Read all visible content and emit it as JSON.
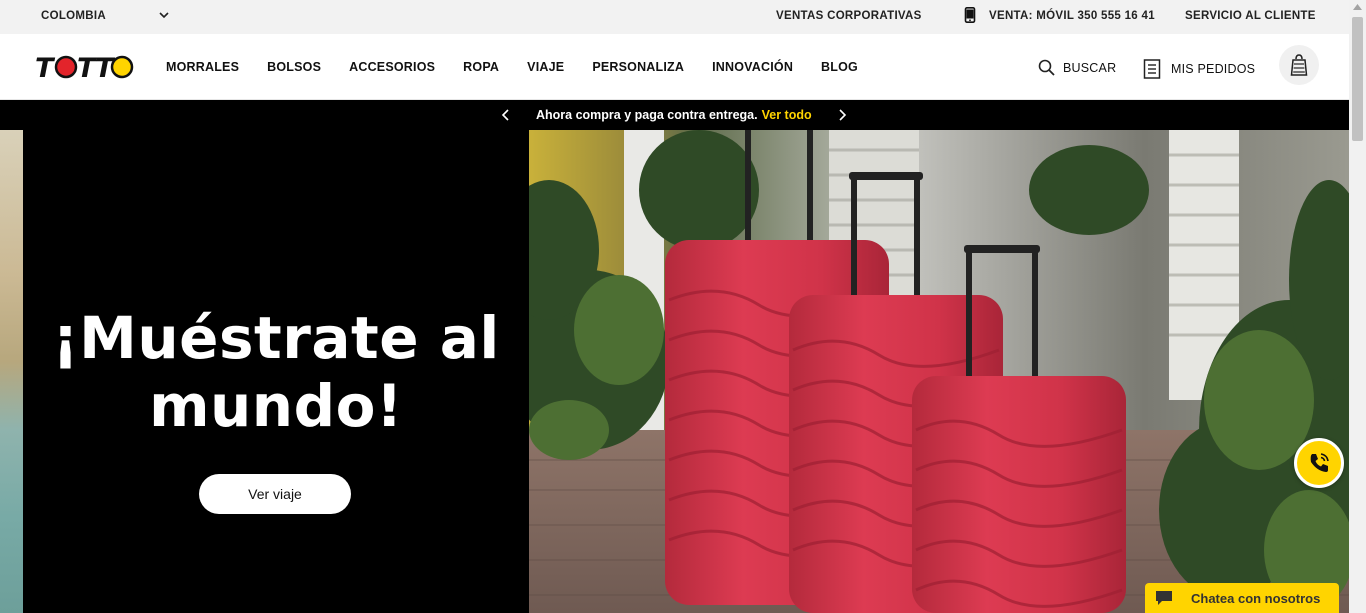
{
  "topbar": {
    "country": "COLOMBIA",
    "corporate_sales": "VENTAS CORPORATIVAS",
    "phone_sales": "VENTA: MÓVIL 350 555 16 41",
    "customer_service": "SERVICIO AL CLIENTE"
  },
  "header": {
    "logo_text": "TOTTO",
    "nav": [
      "MORRALES",
      "BOLSOS",
      "ACCESORIOS",
      "ROPA",
      "VIAJE",
      "PERSONALIZA",
      "INNOVACIÓN",
      "BLOG"
    ],
    "search_label": "BUSCAR",
    "orders_label": "MIS PEDIDOS"
  },
  "promo": {
    "message": "Ahora compra y paga contra entrega.",
    "link": "Ver todo"
  },
  "hero": {
    "title_line1": "¡Muéstrate al",
    "title_line2": "mundo!",
    "cta": "Ver viaje"
  },
  "chat": {
    "label": "Chatea con nosotros"
  },
  "colors": {
    "accent_yellow": "#ffd400",
    "brand_red": "#e3242b",
    "black": "#000000",
    "suitcase": "#d9334d"
  },
  "icons": [
    "chevron-down-icon",
    "phone-icon",
    "search-icon",
    "receipt-icon",
    "shopping-bag-icon",
    "chevron-left-icon",
    "chevron-right-icon",
    "phone-call-icon",
    "chat-bubble-icon"
  ]
}
